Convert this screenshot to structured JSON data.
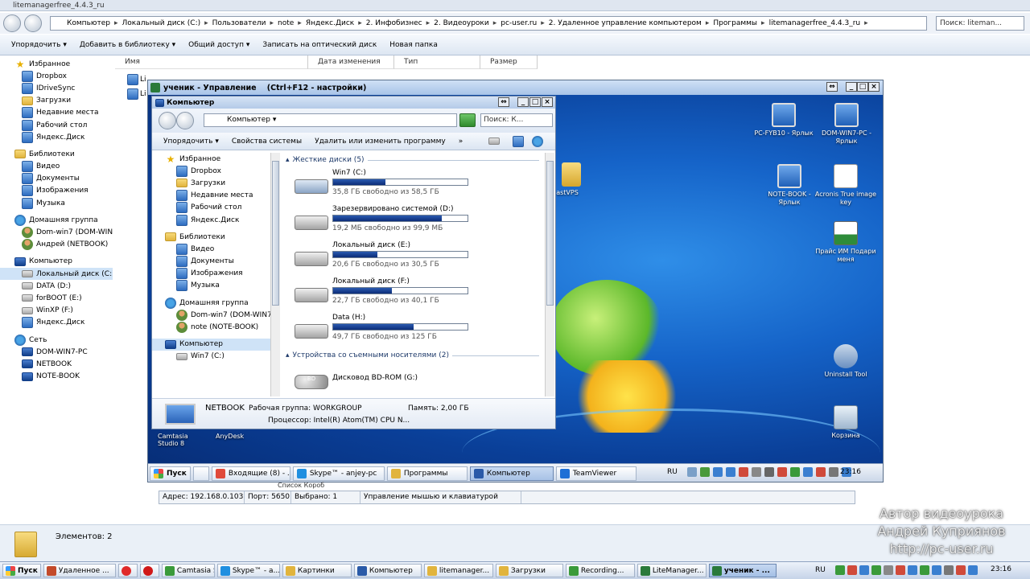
{
  "outer": {
    "title": "litemanagerfree_4.4.3_ru",
    "address_parts": [
      "Компьютер",
      "Локальный диск (C:)",
      "Пользователи",
      "note",
      "Яндекс.Диск",
      "2. Инфобизнес",
      "2. Видеоуроки",
      "pc-user.ru",
      "2. Удаленное управление компьютером",
      "Программы",
      "litemanagerfree_4.4.3_ru"
    ],
    "search_placeholder": "Поиск: liteman...",
    "toolbar": [
      "Упорядочить",
      "Добавить в библиотеку",
      "Общий доступ",
      "Записать на оптический диск",
      "Новая папка"
    ],
    "columns": [
      "Имя",
      "Дата изменения",
      "Тип",
      "Размер"
    ],
    "nav": [
      {
        "label": "Избранное",
        "icon": "star-icon",
        "level": 0
      },
      {
        "label": "Dropbox",
        "icon": "dropbox-icon",
        "level": 1
      },
      {
        "label": "IDriveSync",
        "icon": "idrive-icon",
        "level": 1
      },
      {
        "label": "Загрузки",
        "icon": "folder-icon",
        "level": 1
      },
      {
        "label": "Недавние места",
        "icon": "recent-icon",
        "level": 1
      },
      {
        "label": "Рабочий стол",
        "icon": "desktop-icon",
        "level": 1
      },
      {
        "label": "Яндекс.Диск",
        "icon": "yandex-disk-icon",
        "level": 1
      },
      {
        "label": "Библиотеки",
        "icon": "library-icon",
        "level": 0
      },
      {
        "label": "Видео",
        "icon": "video-icon",
        "level": 1
      },
      {
        "label": "Документы",
        "icon": "documents-icon",
        "level": 1
      },
      {
        "label": "Изображения",
        "icon": "pictures-icon",
        "level": 1
      },
      {
        "label": "Музыка",
        "icon": "music-icon",
        "level": 1
      },
      {
        "label": "Домашняя группа",
        "icon": "homegroup-icon",
        "level": 0
      },
      {
        "label": "Dom-win7 (DOM-WIN7",
        "icon": "user-icon",
        "level": 1
      },
      {
        "label": "Андрей (NETBOOK)",
        "icon": "user-icon",
        "level": 1
      },
      {
        "label": "Компьютер",
        "icon": "computer-icon",
        "level": 0
      },
      {
        "label": "Локальный диск (C:)",
        "icon": "drive-icon",
        "level": 1,
        "selected": true
      },
      {
        "label": "DATA (D:)",
        "icon": "drive-icon",
        "level": 1
      },
      {
        "label": "forBOOT (E:)",
        "icon": "drive-icon",
        "level": 1
      },
      {
        "label": "WinXP (F:)",
        "icon": "drive-icon",
        "level": 1
      },
      {
        "label": "Яндекс.Диск",
        "icon": "yandex-disk-icon",
        "level": 1
      },
      {
        "label": "Сеть",
        "icon": "network-icon",
        "level": 0
      },
      {
        "label": "DOM-WIN7-PC",
        "icon": "pc-icon",
        "level": 1
      },
      {
        "label": "NETBOOK",
        "icon": "pc-icon",
        "level": 1
      },
      {
        "label": "NOTE-BOOK",
        "icon": "pc-icon",
        "level": 1
      }
    ],
    "file_prefix": [
      "Li",
      "Li"
    ],
    "status_count": "Элементов: 2"
  },
  "remote": {
    "title": "ученик - Управление    (Ctrl+F12 - настройки)",
    "desktop_icons": [
      {
        "label": "PC-FYB10 - Ярлык",
        "img": "mon"
      },
      {
        "label": "DOM-WIN7-PC - Ярлык",
        "img": "mon"
      },
      {
        "label": "NOTE-BOOK - Ярлык",
        "img": "mon"
      },
      {
        "label": "Acronis True image key",
        "img": "doc"
      },
      {
        "label": "Прайс ИМ Подари меня",
        "img": "xls"
      },
      {
        "label": "Uninstall Tool",
        "img": "tool"
      },
      {
        "label": "Корзина",
        "img": "bin"
      }
    ],
    "partial_folder_label": "astVPS",
    "camtasia_label": "Camtasia Studio 8",
    "anydesk_label": "AnyDesk",
    "taskbar": {
      "start": "Пуск",
      "buttons": [
        "Входящие (8) - ...",
        "Skype™ - anjey-pc",
        "Программы",
        "Компьютер",
        "TeamViewer"
      ],
      "active": "Компьютер",
      "lang": "RU",
      "clock": "23:16"
    },
    "status": [
      "Адрес: 192.168.0.103",
      "Порт: 5650",
      "Выбрано: 1",
      "Управление мышью и клавиатурой"
    ],
    "tabs_partial": "Список  Короб"
  },
  "inner": {
    "title": "Компьютер",
    "address": "Компьютер",
    "search_placeholder": "Поиск: К...",
    "toolbar": [
      "Упорядочить",
      "Свойства системы",
      "Удалить или изменить программу",
      "»"
    ],
    "nav": [
      {
        "label": "Избранное",
        "level": 0,
        "icon": "star-icon"
      },
      {
        "label": "Dropbox",
        "level": 1,
        "icon": "dropbox-icon"
      },
      {
        "label": "Загрузки",
        "level": 1,
        "icon": "folder-icon"
      },
      {
        "label": "Недавние места",
        "level": 1,
        "icon": "recent-icon"
      },
      {
        "label": "Рабочий стол",
        "level": 1,
        "icon": "desktop-icon"
      },
      {
        "label": "Яндекс.Диск",
        "level": 1,
        "icon": "yandex-disk-icon"
      },
      {
        "label": "Библиотеки",
        "level": 0,
        "icon": "library-icon"
      },
      {
        "label": "Видео",
        "level": 1,
        "icon": "video-icon"
      },
      {
        "label": "Документы",
        "level": 1,
        "icon": "documents-icon"
      },
      {
        "label": "Изображения",
        "level": 1,
        "icon": "pictures-icon"
      },
      {
        "label": "Музыка",
        "level": 1,
        "icon": "music-icon"
      },
      {
        "label": "Домашняя группа",
        "level": 0,
        "icon": "homegroup-icon"
      },
      {
        "label": "Dom-win7 (DOM-WIN7-",
        "level": 1,
        "icon": "user-icon"
      },
      {
        "label": "note (NOTE-BOOK)",
        "level": 1,
        "icon": "user-icon"
      },
      {
        "label": "Компьютер",
        "level": 0,
        "icon": "computer-icon",
        "selected": true
      },
      {
        "label": "Win7 (C:)",
        "level": 1,
        "icon": "drive-icon"
      }
    ],
    "hdd_group": "Жесткие диски (5)",
    "drives": [
      {
        "name": "Win7 (C:)",
        "free": "35,8 ГБ свободно из 58,5 ГБ",
        "used_fraction": 0.39,
        "win": true
      },
      {
        "name": "Зарезервировано системой (D:)",
        "free": "19,2 МБ свободно из 99,9 МБ",
        "used_fraction": 0.81
      },
      {
        "name": "Локальный диск (E:)",
        "free": "20,6 ГБ свободно из 30,5 ГБ",
        "used_fraction": 0.33
      },
      {
        "name": "Локальный диск (F:)",
        "free": "22,7 ГБ свободно из 40,1 ГБ",
        "used_fraction": 0.44
      },
      {
        "name": "Data (H:)",
        "free": "49,7 ГБ свободно из 125 ГБ",
        "used_fraction": 0.6
      }
    ],
    "removable_group": "Устройства со съемными носителями (2)",
    "removable": [
      {
        "name": "Дисковод BD-ROM (G:)",
        "badge": "BD"
      }
    ],
    "details": {
      "name": "NETBOOK",
      "workgroup": "Рабочая группа: WORKGROUP",
      "memory": "Память: 2,00 ГБ",
      "cpu": "Процессор: Intel(R) Atom(TM) CPU N..."
    }
  },
  "taskbar": {
    "start": "Пуск",
    "buttons": [
      {
        "label": "Удаленное ...",
        "color": "#c34a2a"
      },
      {
        "label": "Camtasia St...",
        "color": "#3a9a3a"
      },
      {
        "label": "Skype™ - a...",
        "color": "#1f8fe0"
      },
      {
        "label": "Картинки",
        "color": "#e1b43d"
      },
      {
        "label": "Компьютер",
        "color": "#2a5aa8"
      },
      {
        "label": "litemanager...",
        "color": "#e1b43d"
      },
      {
        "label": "Загрузки",
        "color": "#e1b43d"
      },
      {
        "label": "Recording...",
        "color": "#3a9a3a"
      },
      {
        "label": "LiteManager...",
        "color": "#2a7a3a"
      },
      {
        "label": "ученик - ...",
        "color": "#2a7a3a",
        "active": true
      }
    ],
    "lang": "RU",
    "clock": "23:16"
  },
  "watermark": [
    "Автор видеоурока",
    "Андрей Куприянов",
    "http://pc-user.ru"
  ]
}
